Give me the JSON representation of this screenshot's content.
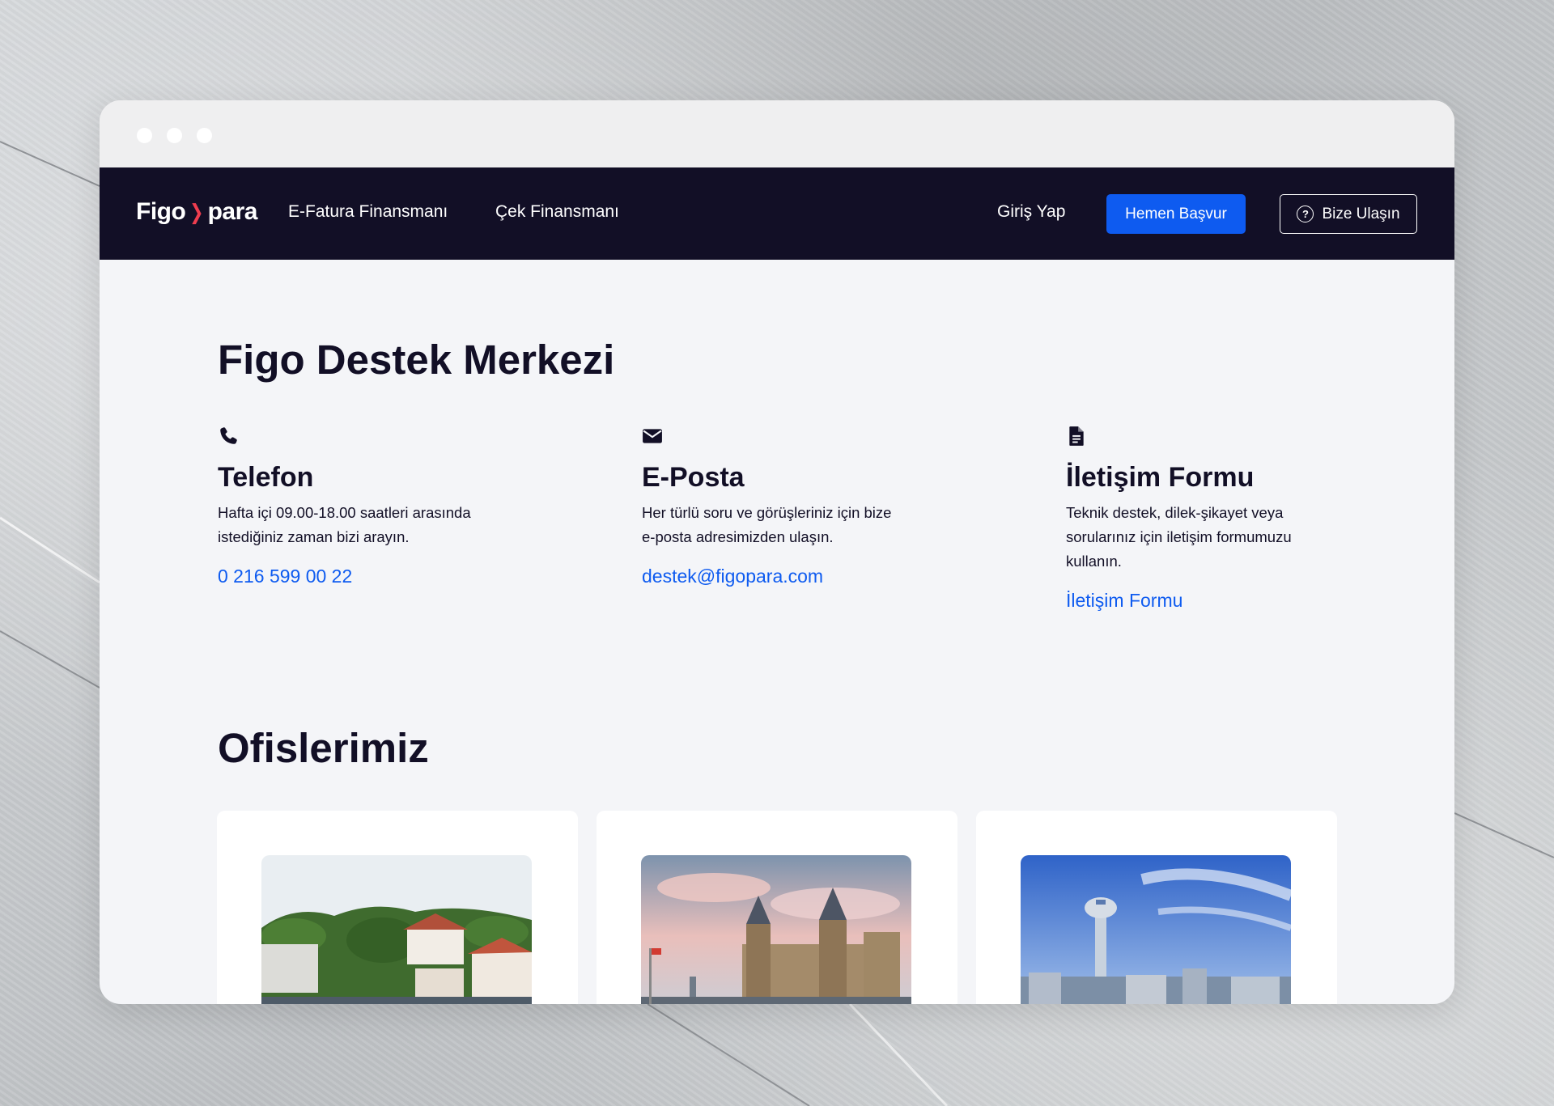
{
  "window": {
    "traffic_lights": [
      "close",
      "minimize",
      "maximize"
    ]
  },
  "navbar": {
    "logo": {
      "part1": "Figo",
      "part2": "para",
      "icon": "chevron-right-icon"
    },
    "links": [
      "E-Fatura Finansmanı",
      "Çek Finansmanı"
    ],
    "login_label": "Giriş Yap",
    "apply_label": "Hemen Başvur",
    "contact_label": "Bize Ulaşın",
    "contact_icon": "help-circle-icon",
    "colors": {
      "background": "#120f26",
      "primary": "#0e5bf0",
      "logo_accent": "#ef3d4f"
    }
  },
  "main": {
    "title": "Figo Destek Merkezi",
    "contacts": [
      {
        "icon": "phone-icon",
        "title": "Telefon",
        "description": "Hafta içi 09.00-18.00 saatleri arasında istediğiniz zaman bizi arayın.",
        "link": "0 216 599 00 22"
      },
      {
        "icon": "envelope-icon",
        "title": "E-Posta",
        "description": "Her türlü soru ve görüşleriniz için bize e-posta adresimizden ulaşın.",
        "link": "destek@figopara.com"
      },
      {
        "icon": "document-icon",
        "title": "İletişim Formu",
        "description": "Teknik destek, dilek-şikayet veya sorularınız için iletişim formumuzu kullanın.",
        "link": "İletişim Formu"
      }
    ],
    "offices_title": "Ofislerimiz",
    "offices": [
      {
        "image": "bosphorus-waterfront-photo"
      },
      {
        "image": "historic-train-station-photo"
      },
      {
        "image": "city-tower-skyline-photo"
      }
    ]
  }
}
